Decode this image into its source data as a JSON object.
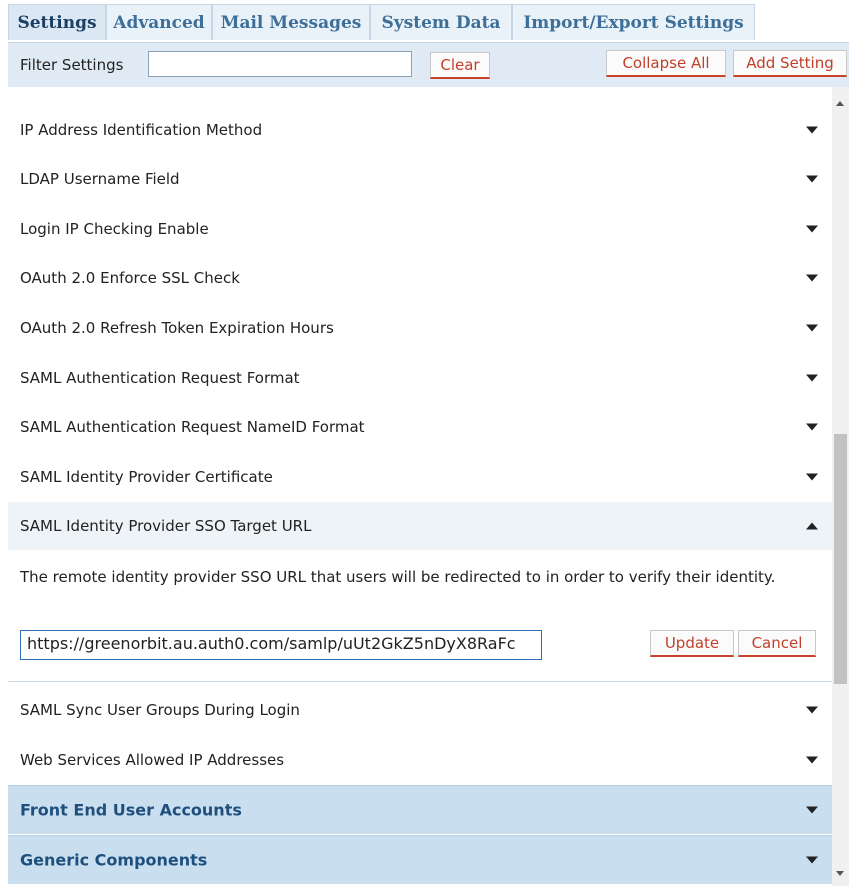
{
  "tabs": [
    {
      "label": "Settings",
      "active": true
    },
    {
      "label": "Advanced",
      "active": false
    },
    {
      "label": "Mail Messages",
      "active": false
    },
    {
      "label": "System Data",
      "active": false
    },
    {
      "label": "Import/Export Settings",
      "active": false
    }
  ],
  "filter": {
    "label": "Filter Settings",
    "value": "",
    "clear_label": "Clear",
    "collapse_all_label": "Collapse All",
    "add_setting_label": "Add Setting"
  },
  "settings": [
    {
      "label": "IP Address Identification Method",
      "expanded": false
    },
    {
      "label": "LDAP Username Field",
      "expanded": false
    },
    {
      "label": "Login IP Checking Enable",
      "expanded": false
    },
    {
      "label": "OAuth 2.0 Enforce SSL Check",
      "expanded": false
    },
    {
      "label": "OAuth 2.0 Refresh Token Expiration Hours",
      "expanded": false
    },
    {
      "label": "SAML Authentication Request Format",
      "expanded": false
    },
    {
      "label": "SAML Authentication Request NameID Format",
      "expanded": false
    },
    {
      "label": "SAML Identity Provider Certificate",
      "expanded": false
    },
    {
      "label": "SAML Identity Provider SSO Target URL",
      "expanded": true
    }
  ],
  "expanded_setting": {
    "description": "The remote identity provider SSO URL that users will be redirected to in order to verify their identity.",
    "value": "https://greenorbit.au.auth0.com/samlp/uUt2GkZ5nDyX8RaFc",
    "update_label": "Update",
    "cancel_label": "Cancel"
  },
  "settings_after": [
    {
      "label": "SAML Sync User Groups During Login"
    },
    {
      "label": "Web Services Allowed IP Addresses"
    }
  ],
  "groups": [
    {
      "label": "Front End User Accounts"
    },
    {
      "label": "Generic Components"
    }
  ],
  "colors": {
    "tab_text": "#3d6f98",
    "button_text": "#c23f28",
    "group_background": "#c9dff0",
    "group_text": "#1f4f7d"
  }
}
